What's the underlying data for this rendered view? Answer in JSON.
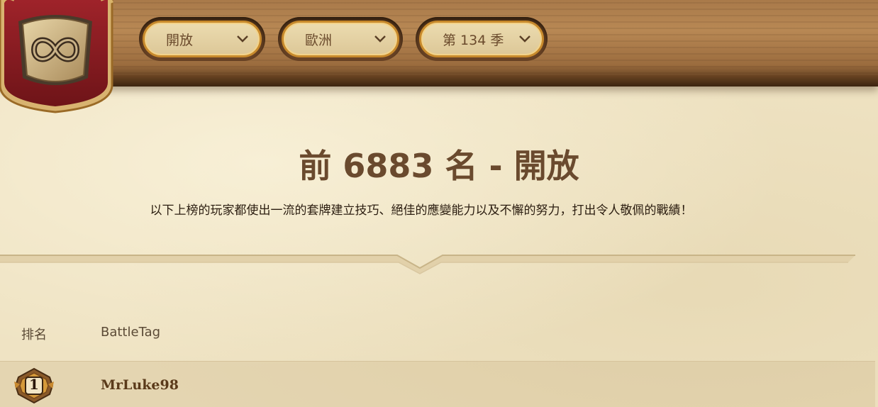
{
  "filters": {
    "mode": "開放",
    "region": "歐洲",
    "season": "第 134 季"
  },
  "title": "前 6883 名 - 開放",
  "subtitle": "以下上榜的玩家都使出一流的套牌建立技巧、絕佳的應變能力以及不懈的努力，打出令人敬佩的戰績！",
  "table": {
    "headers": {
      "rank": "排名",
      "battletag": "BattleTag"
    },
    "rows": [
      {
        "rank": "1",
        "battletag": "MrLuke98"
      }
    ]
  },
  "icons": {
    "emblem": "infinity-shield-icon",
    "dropdown": "chevron-down-icon",
    "rank_badge": "rank-medal-icon"
  },
  "colors": {
    "banner_red": "#8e1b22",
    "gold_border": "#c88a2c",
    "title_brown": "#6a4a2e"
  }
}
